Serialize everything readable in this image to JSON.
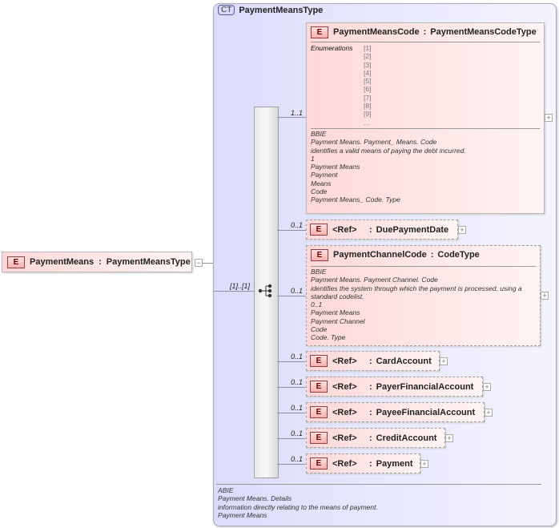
{
  "root": {
    "badge": "E",
    "name": "PaymentMeans",
    "type": "PaymentMeansType",
    "cardinality": "[1]..[1]"
  },
  "complex_type": {
    "badge": "CT",
    "name": "PaymentMeansType",
    "doc": [
      "ABIE",
      "Payment Means. Details",
      "information directly relating to the means of payment.",
      "Payment Means"
    ]
  },
  "children": [
    {
      "badge": "E",
      "name": "PaymentMeansCode",
      "type": "PaymentMeansCodeType",
      "cardinality": "1..1",
      "enum_label": "Enumerations",
      "enums": [
        "[1]",
        "[2]",
        "[3]",
        "[4]",
        "[5]",
        "[6]",
        "[7]",
        "[8]",
        "[9]",
        "..."
      ],
      "doc": [
        "BBIE",
        "Payment Means. Payment_ Means. Code",
        "identifies a valid means of paying the debt incurred.",
        "1",
        "Payment Means",
        "Payment",
        "Means",
        "Code",
        "Payment Means_ Code. Type"
      ]
    },
    {
      "badge": "E",
      "ref": "<Ref>",
      "name": "DuePaymentDate",
      "cardinality": "0..1"
    },
    {
      "badge": "E",
      "name": "PaymentChannelCode",
      "type": "CodeType",
      "cardinality": "0..1",
      "doc": [
        "BBIE",
        "Payment Means. Payment Channel. Code",
        "identifies the system through which the payment is processed, using a standard codelist.",
        "0..1",
        "Payment Means",
        "Payment Channel",
        "Code",
        "Code. Type"
      ]
    },
    {
      "badge": "E",
      "ref": "<Ref>",
      "name": "CardAccount",
      "cardinality": "0..1"
    },
    {
      "badge": "E",
      "ref": "<Ref>",
      "name": "PayerFinancialAccount",
      "cardinality": "0..1"
    },
    {
      "badge": "E",
      "ref": "<Ref>",
      "name": "PayeeFinancialAccount",
      "cardinality": "0..1"
    },
    {
      "badge": "E",
      "ref": "<Ref>",
      "name": "CreditAccount",
      "cardinality": "0..1"
    },
    {
      "badge": "E",
      "ref": "<Ref>",
      "name": "Payment",
      "cardinality": "0..1"
    }
  ],
  "icons": {
    "expand": "+",
    "collapse": "−"
  }
}
